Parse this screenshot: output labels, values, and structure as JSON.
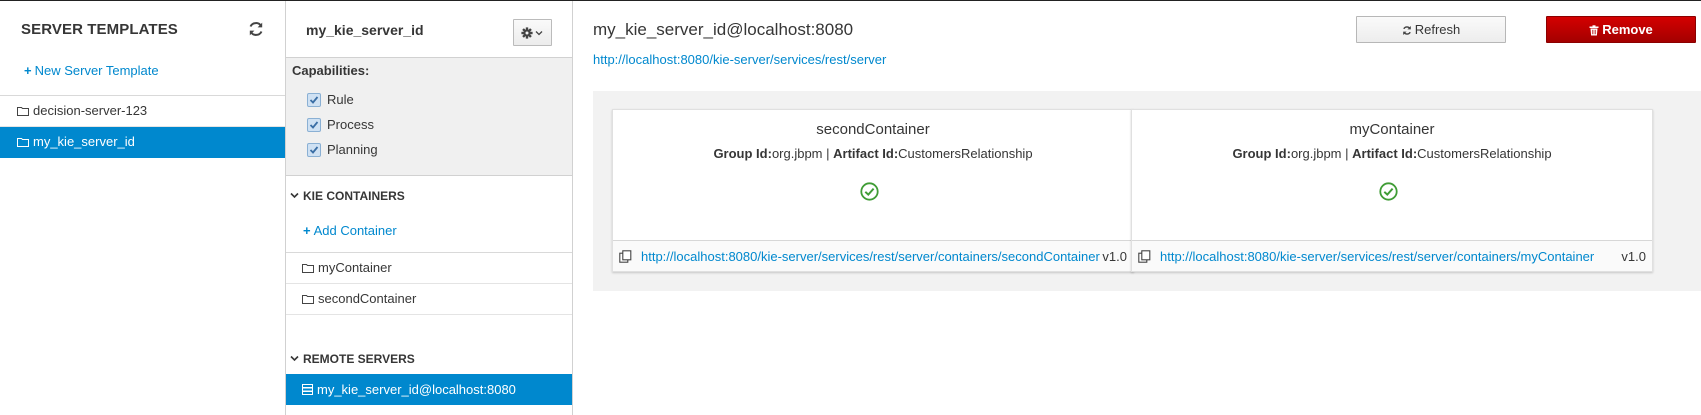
{
  "templates_panel": {
    "title": "SERVER TEMPLATES",
    "new_template_label": "New Server Template",
    "items": [
      {
        "label": "decision-server-123",
        "selected": false
      },
      {
        "label": "my_kie_server_id",
        "selected": true
      }
    ]
  },
  "template_detail": {
    "name": "my_kie_server_id",
    "capabilities_title": "Capabilities:",
    "capabilities": [
      {
        "label": "Rule",
        "checked": true
      },
      {
        "label": "Process",
        "checked": true
      },
      {
        "label": "Planning",
        "checked": true
      }
    ],
    "kie_containers": {
      "title": "KIE CONTAINERS",
      "add_label": "Add Container",
      "items": [
        "myContainer",
        "secondContainer"
      ]
    },
    "remote_servers": {
      "title": "REMOTE SERVERS",
      "items": [
        "my_kie_server_id@localhost:8080"
      ]
    }
  },
  "server_detail": {
    "title": "my_kie_server_id@localhost:8080",
    "url": "http://localhost:8080/kie-server/services/rest/server",
    "refresh_label": "Refresh",
    "remove_label": "Remove",
    "cards": [
      {
        "name": "secondContainer",
        "group_label": "Group Id:",
        "group_value": "org.jbpm",
        "separator": "|",
        "artifact_label": "Artifact Id:",
        "artifact_value": "CustomersRelationship",
        "status": "healthy",
        "url": "http://localhost:8080/kie-server/services/rest/server/containers/secondContainer",
        "version": "v1.0"
      },
      {
        "name": "myContainer",
        "group_label": "Group Id:",
        "group_value": "org.jbpm",
        "separator": "|",
        "artifact_label": "Artifact Id:",
        "artifact_value": "CustomersRelationship",
        "status": "healthy",
        "url": "http://localhost:8080/kie-server/services/rest/server/containers/myContainer",
        "version": "v1.0"
      }
    ]
  },
  "colors": {
    "accent": "#0088ce",
    "danger": "#cc0000",
    "success": "#3f9c35",
    "panel_bg": "#f0f0f0"
  }
}
